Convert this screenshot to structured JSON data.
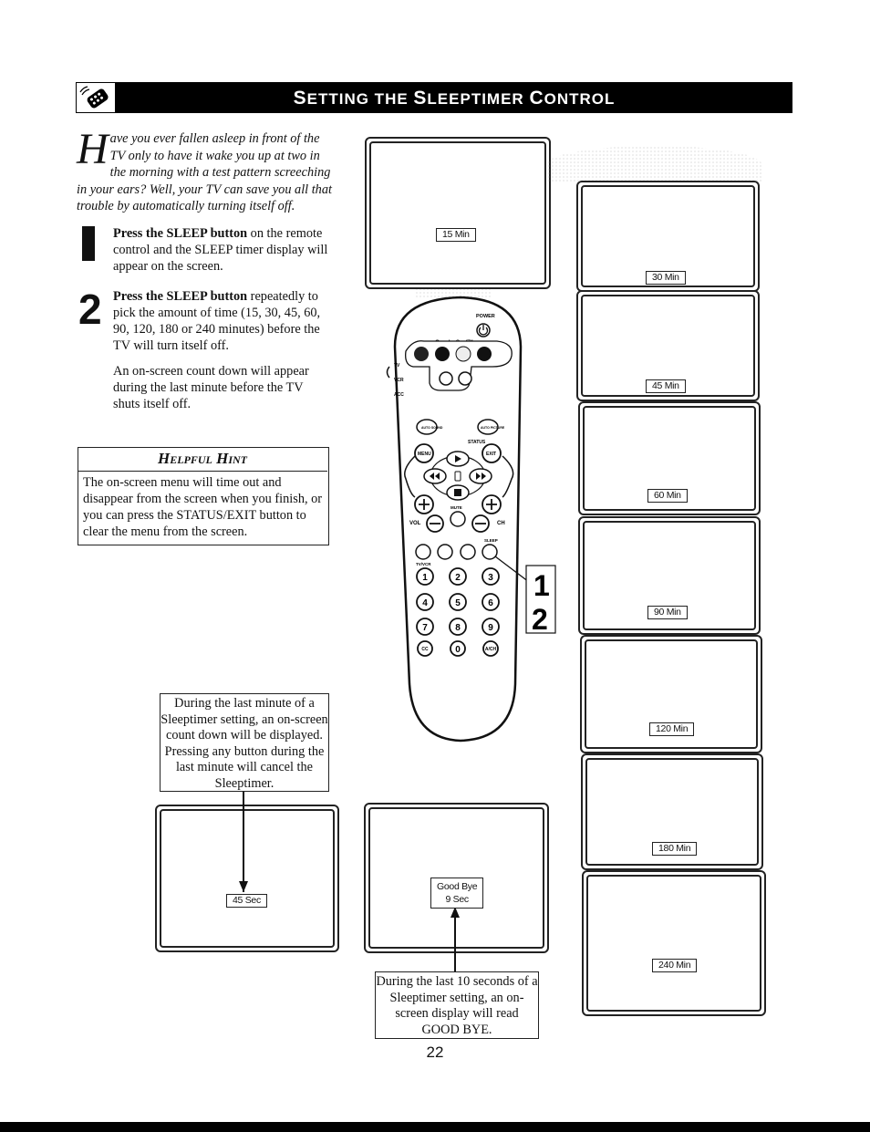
{
  "header": {
    "title_parts": [
      "S",
      "ETTING THE ",
      "S",
      "LEEPTIMER ",
      "C",
      "ONTROL"
    ],
    "title": "Setting the Sleeptimer Control",
    "icon": "remote-control-icon"
  },
  "intro": {
    "dropcap": "H",
    "text": "ave you ever fallen asleep in front of the TV only to have it wake you up at two in the morning with a test pattern screeching in your ears? Well, your TV can save you all that trouble by automatically turning itself off."
  },
  "steps": [
    {
      "number": "1",
      "bold": "Press the SLEEP button",
      "text": " on the remote control and the SLEEP timer display will appear on the screen."
    },
    {
      "number": "2",
      "bold": "Press the SLEEP button",
      "text": " repeatedly to pick the amount of time (15, 30, 45, 60, 90, 120, 180 or 240 minutes) before the TV will turn itself off.",
      "note": "An on-screen count down will appear during the last minute before the TV shuts itself off."
    }
  ],
  "hint": {
    "title": "Helpful Hint",
    "body": "The on-screen menu will time out and disappear from the screen when you finish, or you can press the STATUS/EXIT button to clear the menu from the screen."
  },
  "screens": {
    "first": "15 Min",
    "sequence": [
      "30 Min",
      "45 Min",
      "60 Min",
      "90 Min",
      "120 Min",
      "180 Min",
      "240 Min"
    ],
    "countdown": "45 Sec",
    "goodbye_line1": "Good Bye",
    "goodbye_line2": "9 Sec"
  },
  "callouts": {
    "last_minute": "During the last minute of a Sleeptimer setting, an on-screen count down will be displayed. Pressing any button during the last minute will cancel the Sleeptimer.",
    "goodbye": "During the last 10 seconds of a Sleeptimer setting, an on-screen display will read GOOD BYE."
  },
  "remote": {
    "power_label": "POWER",
    "brand_label": "QuadraSurf™",
    "mode_labels": [
      "TV",
      "VCR",
      "ACC"
    ],
    "auto_sound": "AUTO SOUND",
    "auto_picture": "AUTO PICTURE",
    "status_label": "STATUS",
    "menu_label": "MENU",
    "exit_label": "EXIT",
    "mute_label": "MUTE",
    "vol_label": "VOL",
    "ch_label": "CH",
    "sleep_label": "SLEEP",
    "tvvcr_label": "TV/VCR",
    "digits": [
      "1",
      "2",
      "3",
      "4",
      "5",
      "6",
      "7",
      "8",
      "9"
    ],
    "bottom_keys": [
      "CC",
      "0",
      "A/CH"
    ],
    "step_callout": [
      "1",
      "2"
    ]
  },
  "page_number": "22"
}
